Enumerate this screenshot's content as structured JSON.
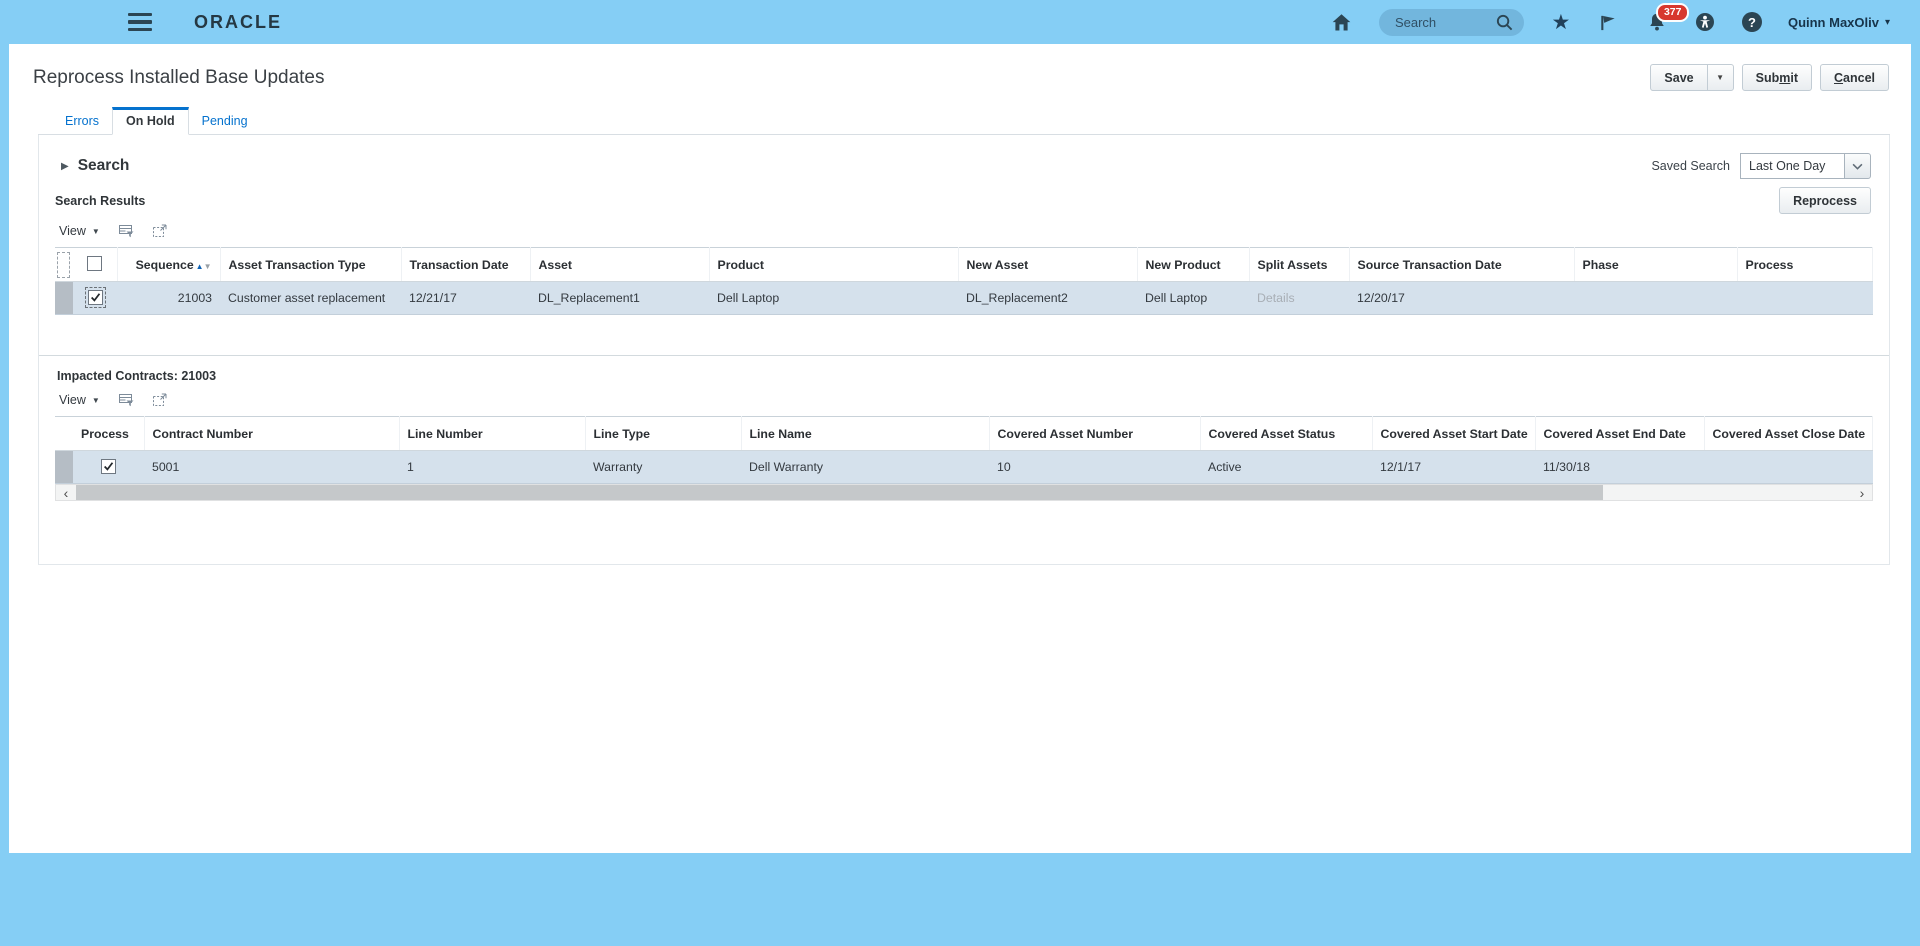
{
  "colors": {
    "accent": "#0572ce",
    "topbar_bg": "#85cef5",
    "selected_row": "#d5e1ec",
    "badge_red": "#d7382e"
  },
  "icons": {
    "star": "★",
    "user_caret": "▾",
    "menu_caret": "▼",
    "save_caret": "▼",
    "disclosure": "▶",
    "sort_asc": "▲",
    "sort_desc": "▼",
    "scroll_left": "‹",
    "scroll_right": "›",
    "help": "?"
  },
  "topbar": {
    "logo": "ORACLE",
    "search_placeholder": "Search",
    "notification_count": "377",
    "user_name": "Quinn MaxOliv"
  },
  "page": {
    "title": "Reprocess Installed Base Updates",
    "save_label": "Save",
    "submit_pre": "Sub",
    "submit_key": "m",
    "submit_post": "it",
    "cancel_key": "C",
    "cancel_post": "ancel"
  },
  "tabs": {
    "errors": "Errors",
    "on_hold": "On Hold",
    "pending": "Pending"
  },
  "search": {
    "title": "Search",
    "saved_search_label": "Saved Search",
    "saved_search_value": "Last One Day"
  },
  "results": {
    "title": "Search Results",
    "view_label": "View",
    "reprocess_label": "Reprocess",
    "columns": [
      "Sequence",
      "Asset Transaction Type",
      "Transaction Date",
      "Asset",
      "Product",
      "New Asset",
      "New Product",
      "Split Assets",
      "Source Transaction Date",
      "Phase",
      "Process"
    ],
    "row": {
      "sequence": "21003",
      "asset_transaction_type": "Customer asset replacement",
      "transaction_date": "12/21/17",
      "asset": "DL_Replacement1",
      "product": "Dell Laptop",
      "new_asset": "DL_Replacement2",
      "new_product": "Dell Laptop",
      "split_assets": "Details",
      "source_transaction_date": "12/20/17",
      "phase": "",
      "process": ""
    }
  },
  "contracts": {
    "title": "Impacted Contracts: 21003",
    "view_label": "View",
    "columns": [
      "Process",
      "Contract Number",
      "Line Number",
      "Line Type",
      "Line Name",
      "Covered Asset Number",
      "Covered Asset Status",
      "Covered Asset Start Date",
      "Covered Asset End Date",
      "Covered Asset Close Date"
    ],
    "row": {
      "contract_number": "5001",
      "line_number": "1",
      "line_type": "Warranty",
      "line_name": "Dell Warranty",
      "covered_asset_number": "10",
      "covered_asset_status": "Active",
      "covered_asset_start_date": "12/1/17",
      "covered_asset_end_date": "11/30/18",
      "covered_asset_close_date": ""
    }
  }
}
